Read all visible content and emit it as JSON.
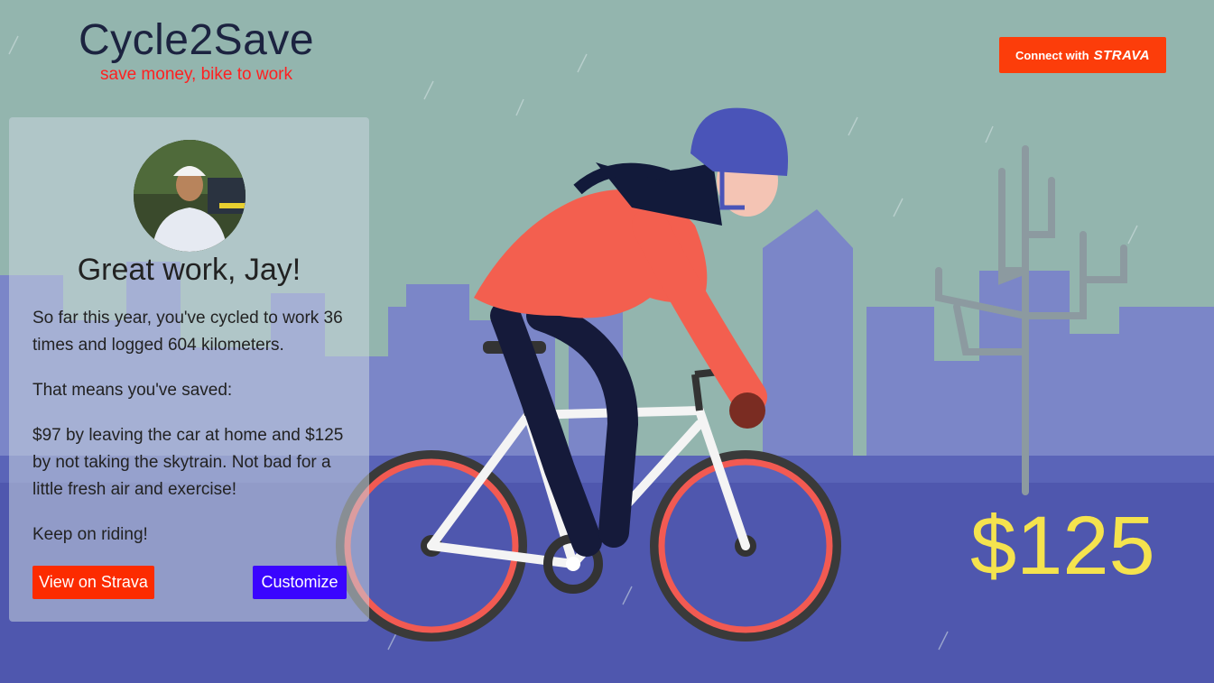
{
  "header": {
    "title": "Cycle2Save",
    "tagline": "save money, bike to work",
    "connect_label": "Connect with",
    "connect_logo": "STRAVA"
  },
  "card": {
    "greeting": "Great work, Jay!",
    "paragraphs": [
      "So far this year, you've cycled to work 36 times and logged 604 kilometers.",
      "That means you've saved:",
      "$97 by leaving the car at home and $125 by not taking the skytrain. Not bad for a little fresh air and exercise!",
      "Keep on riding!"
    ],
    "buttons": {
      "view_strava": "View on Strava",
      "customize": "Customize"
    }
  },
  "savings_amount": "$125",
  "colors": {
    "strava_orange": "#fc3d0a",
    "customize_blue": "#3a05ff",
    "savings_yellow": "#f5e34e",
    "tagline_red": "#ff2020"
  },
  "icons": [
    "cyclist-illustration",
    "city-skyline",
    "cactus-illustration",
    "avatar-photo"
  ]
}
